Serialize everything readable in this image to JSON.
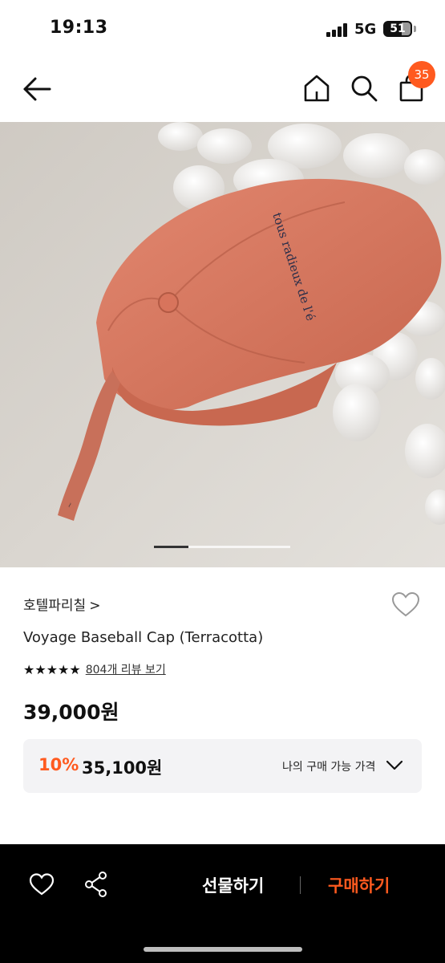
{
  "status_bar": {
    "time": "19:13",
    "network": "5G",
    "battery": "51"
  },
  "header": {
    "cart_count": "35",
    "icons": [
      "back-arrow-icon",
      "home-icon",
      "search-icon",
      "cart-icon"
    ]
  },
  "gallery": {
    "image_alt": "Terracotta baseball cap on stones",
    "cap_text": "tous radieux de l'é",
    "current_slide_fraction": 0.25
  },
  "product": {
    "brand": "호텔파리칠",
    "brand_chevron": ">",
    "name": "Voyage Baseball Cap (Terracotta)",
    "stars": "★★★★★",
    "review_link": "804개 리뷰 보기",
    "price": "39,000원"
  },
  "price_box": {
    "discount_rate": "10%",
    "discount_price": "35,100원",
    "my_price_label": "나의 구매 가능 가격"
  },
  "bottom_bar": {
    "gift_label": "선물하기",
    "buy_label": "구매하기"
  },
  "colors": {
    "accent": "#ff5a1f",
    "bottom_bar_bg": "#000000",
    "price_box_bg": "#f3f3f5"
  }
}
